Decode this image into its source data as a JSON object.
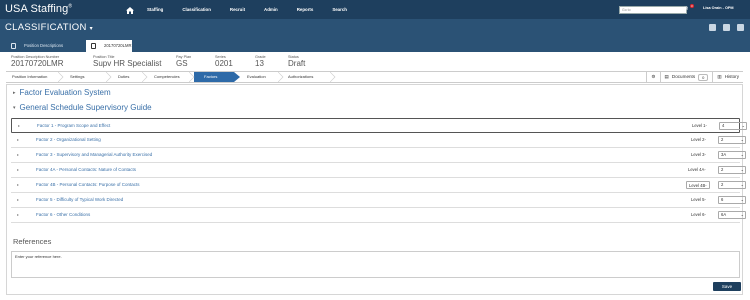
{
  "brand": {
    "name": "USA Staffing",
    "mark": "®"
  },
  "topnav": {
    "items": [
      "Staffing",
      "Classification",
      "Recruit",
      "Admin",
      "Reports",
      "Search"
    ],
    "goto_placeholder": "Go to",
    "mail_badge": "3",
    "user": "Lisa Orain - OPM"
  },
  "subnav": {
    "title": "CLASSIFICATION"
  },
  "tabs": [
    {
      "label": "Position Descriptions"
    },
    {
      "label": "20170720LMR"
    }
  ],
  "header": {
    "pd_number_label": "Position Description Number",
    "pd_number": "20170720LMR",
    "title_label": "Position Title",
    "title": "Supv HR Specialist",
    "payplan_label": "Pay Plan",
    "payplan": "GS",
    "series_label": "Series",
    "series": "0201",
    "grade_label": "Grade",
    "grade": "13",
    "status_label": "Status",
    "status": "Draft"
  },
  "steps": [
    "Position Information",
    "Settings",
    "Duties",
    "Competencies",
    "Factors",
    "Evaluation",
    "Authorizations"
  ],
  "tools": {
    "documents_label": "Documents",
    "documents_count": "0",
    "history_label": "History"
  },
  "sections": {
    "factor_eval": "Factor Evaluation System",
    "supervisory": "General Schedule Supervisory Guide"
  },
  "factors": [
    {
      "name": "Factor 1 - Program Scope and Effect",
      "level": "Level 1-",
      "value": "4"
    },
    {
      "name": "Factor 2 - Organizational Setting",
      "level": "Level 2-",
      "value": "2"
    },
    {
      "name": "Factor 3 - Supervisory and Managerial Authority Exercised",
      "level": "Level 3-",
      "value": "3A"
    },
    {
      "name": "Factor 4A - Personal Contacts: Nature of Contacts",
      "level": "Level 4A-",
      "value": "2"
    },
    {
      "name": "Factor 4B - Personal Contacts: Purpose of Contacts",
      "level": "Level 4B-",
      "value": "2"
    },
    {
      "name": "Factor 5 - Difficulty of Typical Work Directed",
      "level": "Level 5-",
      "value": "6"
    },
    {
      "name": "Factor 6 - Other Conditions",
      "level": "Level 6-",
      "value": "6A"
    }
  ],
  "references": {
    "title": "References",
    "placeholder": "Enter your reference here."
  },
  "save_label": "Save"
}
